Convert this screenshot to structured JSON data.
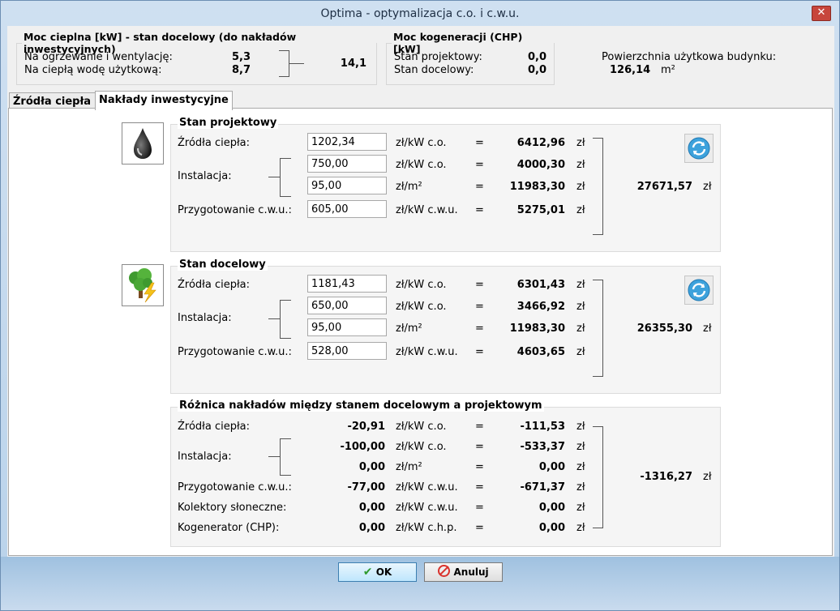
{
  "window": {
    "title": "Optima - optymalizacja c.o. i c.w.u.",
    "close_label": "✕"
  },
  "moc_cieplna": {
    "legend": "Moc cieplna [kW] - stan docelowy (do nakładów inwestycyjnych)",
    "row1_label": "Na ogrzewanie i wentylację:",
    "row1_value": "5,3",
    "row2_label": "Na ciepłą wodę użytkową:",
    "row2_value": "8,7",
    "total": "14,1"
  },
  "kogeneracja": {
    "legend": "Moc kogeneracji (CHP) [kW]",
    "row1_label": "Stan projektowy:",
    "row1_value": "0,0",
    "row2_label": "Stan docelowy:",
    "row2_value": "0,0"
  },
  "powierzchnia": {
    "label": "Powierzchnia użytkowa budynku:",
    "value": "126,14",
    "unit": "m²"
  },
  "tabs": [
    {
      "label": "Źródła ciepła",
      "active": false
    },
    {
      "label": "Nakłady inwestycyjne",
      "active": true
    }
  ],
  "projektowy": {
    "title": "Stan projektowy",
    "icon": "oil-drop-icon",
    "rows": [
      {
        "label": "Źródła ciepła:",
        "input": "1202,34",
        "unit": "zł/kW c.o.",
        "eq": "=",
        "value": "6412,96",
        "cur": "zł"
      },
      {
        "label": "",
        "input": "750,00",
        "unit": "zł/kW c.o.",
        "eq": "=",
        "value": "4000,30",
        "cur": "zł"
      },
      {
        "label": "",
        "input": "95,00",
        "unit": "zł/m²",
        "eq": "=",
        "value": "11983,30",
        "cur": "zł"
      },
      {
        "label": "Przygotowanie c.w.u.:",
        "input": "605,00",
        "unit": "zł/kW c.w.u.",
        "eq": "=",
        "value": "5275,01",
        "cur": "zł"
      }
    ],
    "instalacja_label": "Instalacja:",
    "total": "27671,57",
    "total_cur": "zł"
  },
  "docelowy": {
    "title": "Stan docelowy",
    "icon": "eco-tree-icon",
    "rows": [
      {
        "label": "Źródła ciepła:",
        "input": "1181,43",
        "unit": "zł/kW c.o.",
        "eq": "=",
        "value": "6301,43",
        "cur": "zł"
      },
      {
        "label": "",
        "input": "650,00",
        "unit": "zł/kW c.o.",
        "eq": "=",
        "value": "3466,92",
        "cur": "zł"
      },
      {
        "label": "",
        "input": "95,00",
        "unit": "zł/m²",
        "eq": "=",
        "value": "11983,30",
        "cur": "zł"
      },
      {
        "label": "Przygotowanie c.w.u.:",
        "input": "528,00",
        "unit": "zł/kW c.w.u.",
        "eq": "=",
        "value": "4603,65",
        "cur": "zł"
      }
    ],
    "instalacja_label": "Instalacja:",
    "total": "26355,30",
    "total_cur": "zł"
  },
  "roznica": {
    "title": "Różnica nakładów między stanem docelowym a projektowym",
    "rows": [
      {
        "label": "Źródła ciepła:",
        "num": "-20,91",
        "unit": "zł/kW c.o.",
        "eq": "=",
        "value": "-111,53",
        "cur": "zł"
      },
      {
        "label": "",
        "num": "-100,00",
        "unit": "zł/kW c.o.",
        "eq": "=",
        "value": "-533,37",
        "cur": "zł"
      },
      {
        "label": "",
        "num": "0,00",
        "unit": "zł/m²",
        "eq": "=",
        "value": "0,00",
        "cur": "zł"
      },
      {
        "label": "Przygotowanie c.w.u.:",
        "num": "-77,00",
        "unit": "zł/kW c.w.u.",
        "eq": "=",
        "value": "-671,37",
        "cur": "zł"
      },
      {
        "label": "Kolektory słoneczne:",
        "num": "0,00",
        "unit": "zł/kW c.w.u.",
        "eq": "=",
        "value": "0,00",
        "cur": "zł"
      },
      {
        "label": "Kogenerator (CHP):",
        "num": "0,00",
        "unit": "zł/kW c.h.p.",
        "eq": "=",
        "value": "0,00",
        "cur": "zł"
      }
    ],
    "instalacja_label": "Instalacja:",
    "total": "-1316,27",
    "total_cur": "zł"
  },
  "buttons": {
    "ok": "OK",
    "cancel": "Anuluj"
  },
  "colors": {
    "accent": "#3c7fb1",
    "cancel_icon": "#d9312b",
    "ok_icon": "#2e9a2e"
  }
}
